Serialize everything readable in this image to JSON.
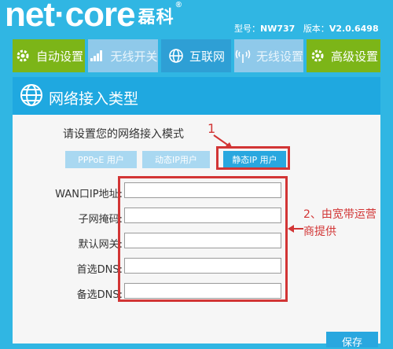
{
  "header": {
    "logo_text": "net·core",
    "logo_cn": "磊科",
    "model_label": "型号：",
    "model_value": "NW737",
    "version_label": "版本：",
    "version_value": "V2.0.6498"
  },
  "nav": {
    "auto_setup": "自动设置",
    "wifi_switch": "无线开关",
    "internet": "互联网",
    "wifi_settings": "无线设置",
    "advanced": "高级设置"
  },
  "panel": {
    "title": "网络接入类型",
    "mode_prompt": "请设置您的网络接入模式",
    "modes": {
      "pppoe": "PPPoE 用户",
      "dynamic_ip": "动态IP用户",
      "static_ip": "静态IP 用户"
    },
    "fields": {
      "wan_ip": "WAN口IP地址",
      "subnet_mask": "子网掩码",
      "gateway": "默认网关",
      "primary_dns": "首选DNS",
      "secondary_dns": "备选DNS"
    },
    "save": "保存"
  },
  "annotations": {
    "one": "1",
    "two": "2、由宽带运营商提供"
  },
  "colors": {
    "background": "#30b6e3",
    "nav_green": "#7cb518",
    "nav_light": "#8fc9ea",
    "panel_header": "#1fa8e0",
    "annotation_red": "#d23535"
  }
}
